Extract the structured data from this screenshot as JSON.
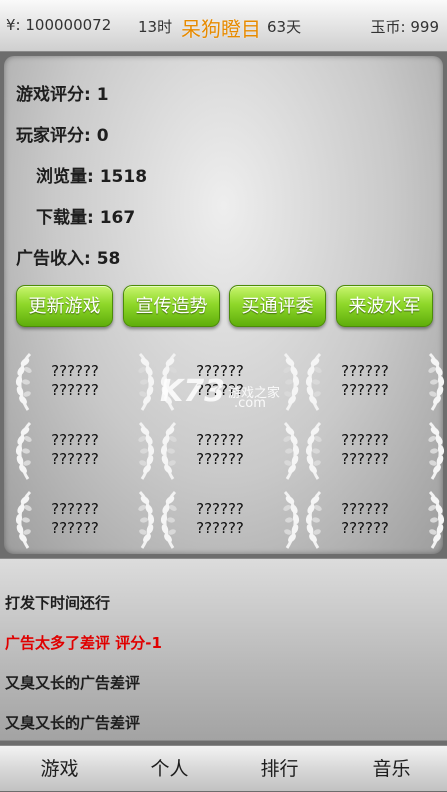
{
  "header": {
    "money": "¥: 100000072",
    "hour": "13时",
    "game_title": "呆狗瞪目",
    "days": "63天",
    "coins": "玉币: 999"
  },
  "stats": [
    {
      "label": "游戏评分: 1"
    },
    {
      "label": "玩家评分: 0"
    },
    {
      "label": "浏览量: 1518"
    },
    {
      "label": "下载量: 167"
    },
    {
      "label": "广告收入: 58"
    }
  ],
  "actions": [
    {
      "label": "更新游戏"
    },
    {
      "label": "宣传造势"
    },
    {
      "label": "买通评委"
    },
    {
      "label": "来波水军"
    }
  ],
  "awards": [
    {
      "line1": "??????",
      "line2": "??????"
    },
    {
      "line1": "??????",
      "line2": "??????"
    },
    {
      "line1": "??????",
      "line2": "??????"
    },
    {
      "line1": "??????",
      "line2": "??????"
    },
    {
      "line1": "??????",
      "line2": "??????"
    },
    {
      "line1": "??????",
      "line2": "??????"
    },
    {
      "line1": "??????",
      "line2": "??????"
    },
    {
      "line1": "??????",
      "line2": "??????"
    },
    {
      "line1": "??????",
      "line2": "??????"
    }
  ],
  "watermark": {
    "logo": "K73",
    "line1": "游戏之家",
    "line2": ".com"
  },
  "log": [
    {
      "text": "打发下时间还行",
      "color": "#1e1e1e"
    },
    {
      "text": "广告太多了差评   评分-1",
      "color": "#e00000"
    },
    {
      "text": "又臭又长的广告差评",
      "color": "#1e1e1e"
    },
    {
      "text": "又臭又长的广告差评",
      "color": "#1e1e1e"
    }
  ],
  "nav": [
    {
      "label": "游戏"
    },
    {
      "label": "个人"
    },
    {
      "label": "排行"
    },
    {
      "label": "音乐"
    }
  ],
  "colors": {
    "title": "#e68a00",
    "button_green": "#8fd82a",
    "log_warning": "#e00000"
  }
}
